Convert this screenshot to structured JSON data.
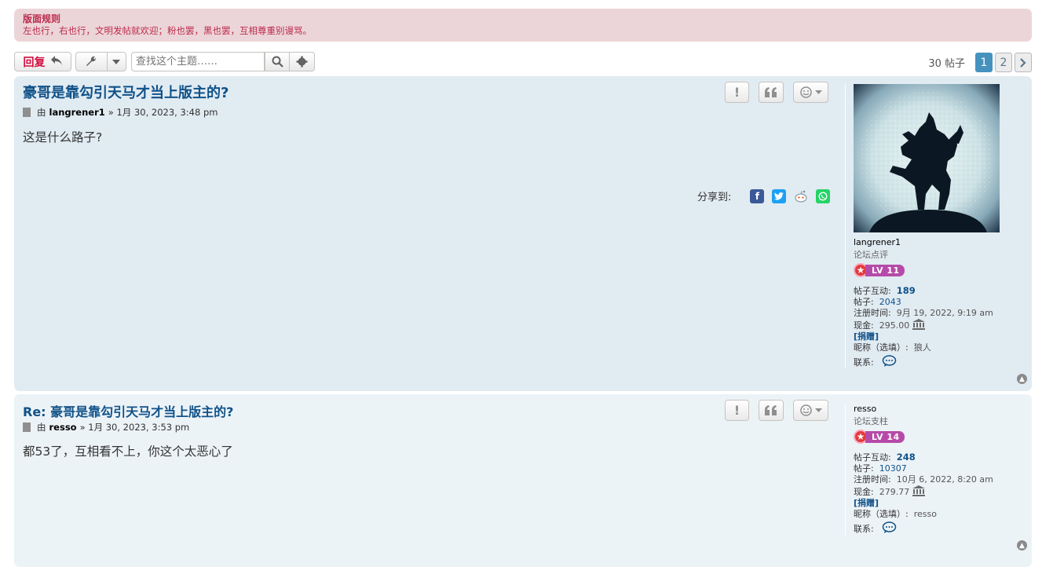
{
  "rules": {
    "title": "版面规则",
    "text": "左也行，右也行，文明发帖就欢迎；粉也罢，黑也罢，互相尊重别谩骂。"
  },
  "toolbar": {
    "reply_label": "回复",
    "search_placeholder": "查找这个主题……"
  },
  "pagination": {
    "count": "30 帖子",
    "pages": [
      "1",
      "2"
    ],
    "active": "1"
  },
  "posts": [
    {
      "title": "豪哥是靠勾引天马才当上版主的?",
      "by": "由",
      "author": "langrener1",
      "sep": "»",
      "date": "1月 30, 2023, 3:48 pm",
      "content": "这是什么路子?",
      "share_label": "分享到:",
      "profile": {
        "username": "langrener1",
        "rank": "论坛点评",
        "level": "LV 11",
        "interact_label": "帖子互动:",
        "interact": "189",
        "posts_label": "帖子:",
        "posts": "2043",
        "joined_label": "注册时间:",
        "joined": "9月 19, 2022, 9:19 am",
        "cash_label": "现金:",
        "cash": "295.00",
        "donate": "[捐赠]",
        "nickname_label": "昵称（选填）:",
        "nickname": "狼人",
        "contact_label": "联系:"
      }
    },
    {
      "title": "Re: 豪哥是靠勾引天马才当上版主的?",
      "by": "由",
      "author": "resso",
      "sep": "»",
      "date": "1月 30, 2023, 3:53 pm",
      "content": "都53了，互相看不上，你这个太恶心了",
      "profile": {
        "username": "resso",
        "rank": "论坛支柱",
        "level": "LV 14",
        "interact_label": "帖子互动:",
        "interact": "248",
        "posts_label": "帖子:",
        "posts": "10307",
        "joined_label": "注册时间:",
        "joined": "10月 6, 2022, 8:20 am",
        "cash_label": "现金:",
        "cash": "279.77",
        "donate": "[捐赠]",
        "nickname_label": "昵称（选填）:",
        "nickname": "resso",
        "contact_label": "联系:"
      }
    }
  ],
  "colors": {
    "rules_bg": "#ecd5d8",
    "rules_text": "#bc2a4d",
    "post_bg_1": "#e1ebf2",
    "post_bg_2": "#ecf3f7",
    "link": "#105289",
    "reply": "#d31141",
    "page_active": "#4692bf"
  },
  "icons": {
    "reply": "reply-arrow-icon",
    "tools": "wrench-icon",
    "search": "magnifier-icon",
    "advanced": "gear-icon",
    "report": "exclamation-icon",
    "quote": "quote-icon",
    "react": "smiley-icon",
    "share": [
      "facebook-icon",
      "twitter-icon",
      "reddit-icon",
      "whatsapp-icon"
    ],
    "cash": "bank-icon",
    "contact": "speech-bubble-icon",
    "top": "chevron-up-icon"
  }
}
